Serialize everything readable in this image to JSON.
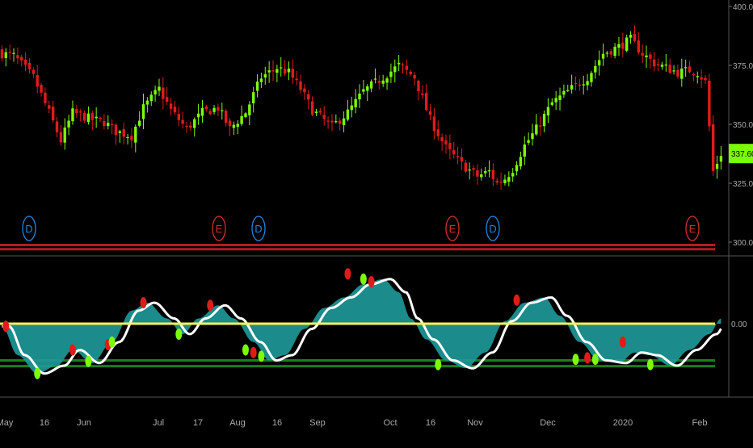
{
  "price_axis": {
    "ticks": [
      "400.00",
      "375.00",
      "350.00",
      "325.00",
      "300.00"
    ],
    "last_price": "337.60"
  },
  "osc_axis": {
    "ticks": [
      "0.00"
    ]
  },
  "time_axis": {
    "labels": [
      "May",
      "16",
      "Jun",
      "Jul",
      "17",
      "Aug",
      "16",
      "Sep",
      "Oct",
      "16",
      "Nov",
      "Dec",
      "2020",
      "Feb"
    ]
  },
  "event_markers": [
    "D",
    "E",
    "D",
    "E",
    "D",
    "E"
  ],
  "colors": {
    "background": "#000000",
    "up_candle": "#7CFC00",
    "down_candle": "#E01B1B",
    "oscillator_fill": "#1E9A9A",
    "oscillator_line": "#FFFFFF",
    "zero_line": "#F5F05A",
    "upper_band": "#B71C1C",
    "lower_band": "#1B7F1B",
    "dividend_marker": "#1E88E5",
    "earnings_marker": "#D32F2F",
    "last_price_tag": "#7CFC00"
  },
  "chart_data": [
    {
      "type": "candlestick",
      "title": "",
      "x_range": [
        0,
        183
      ],
      "ylim": [
        294,
        405
      ],
      "y_ticks": [
        300,
        325,
        350,
        375,
        400
      ],
      "grid": false,
      "last_price": 337.6,
      "close_anchors": [
        [
          0,
          380
        ],
        [
          3,
          379
        ],
        [
          8,
          370
        ],
        [
          12,
          355
        ],
        [
          15,
          343
        ],
        [
          18,
          355
        ],
        [
          23,
          352
        ],
        [
          26,
          351
        ],
        [
          29,
          347
        ],
        [
          33,
          345
        ],
        [
          36,
          357
        ],
        [
          40,
          365
        ],
        [
          43,
          356
        ],
        [
          47,
          348
        ],
        [
          51,
          355
        ],
        [
          55,
          357
        ],
        [
          58,
          348
        ],
        [
          62,
          355
        ],
        [
          66,
          370
        ],
        [
          70,
          374
        ],
        [
          73,
          372
        ],
        [
          76,
          365
        ],
        [
          79,
          356
        ],
        [
          84,
          349
        ],
        [
          88,
          355
        ],
        [
          92,
          364
        ],
        [
          97,
          370
        ],
        [
          101,
          375
        ],
        [
          105,
          370
        ],
        [
          109,
          352
        ],
        [
          113,
          340
        ],
        [
          117,
          333
        ],
        [
          121,
          328
        ],
        [
          124,
          330
        ],
        [
          126,
          325
        ],
        [
          128,
          327
        ],
        [
          130,
          331
        ],
        [
          133,
          341
        ],
        [
          136,
          348
        ],
        [
          140,
          359
        ],
        [
          144,
          364
        ],
        [
          149,
          370
        ],
        [
          153,
          380
        ],
        [
          157,
          383
        ],
        [
          160,
          386
        ],
        [
          163,
          380
        ],
        [
          166,
          376
        ],
        [
          169,
          374
        ],
        [
          172,
          372
        ],
        [
          175,
          373
        ],
        [
          177,
          372
        ],
        [
          179,
          368
        ],
        [
          181,
          330
        ],
        [
          183,
          337.6
        ]
      ],
      "date_labels": [
        "May",
        "16",
        "Jun",
        "Jul",
        "17",
        "Aug",
        "16",
        "Sep",
        "Oct",
        "16",
        "Nov",
        "Dec",
        "2020",
        "Feb"
      ],
      "event_markers": [
        {
          "label": "D",
          "type": "dividend"
        },
        {
          "label": "E",
          "type": "earnings"
        },
        {
          "label": "D",
          "type": "dividend"
        },
        {
          "label": "E",
          "type": "earnings"
        },
        {
          "label": "D",
          "type": "dividend"
        },
        {
          "label": "E",
          "type": "earnings"
        }
      ]
    },
    {
      "type": "area",
      "series_type": "oscillator",
      "ylim": [
        -1.2,
        1.2
      ],
      "y_ticks": [
        0
      ],
      "zero_line": 0,
      "upper_band_lines": [
        0.95,
        0.87
      ],
      "lower_band_lines": [
        -0.7,
        -0.81
      ],
      "curve": [
        [
          0,
          -0.05
        ],
        [
          4,
          -0.6
        ],
        [
          9,
          -0.95
        ],
        [
          14,
          -0.8
        ],
        [
          18,
          -0.5
        ],
        [
          23,
          -0.75
        ],
        [
          28,
          -0.35
        ],
        [
          33,
          0.25
        ],
        [
          37,
          0.4
        ],
        [
          42,
          0.1
        ],
        [
          46,
          -0.2
        ],
        [
          50,
          0.1
        ],
        [
          55,
          0.35
        ],
        [
          59,
          0.1
        ],
        [
          64,
          -0.35
        ],
        [
          68,
          -0.7
        ],
        [
          72,
          -0.6
        ],
        [
          77,
          -0.1
        ],
        [
          82,
          0.3
        ],
        [
          87,
          0.5
        ],
        [
          92,
          0.75
        ],
        [
          97,
          0.85
        ],
        [
          101,
          0.6
        ],
        [
          104,
          0.1
        ],
        [
          108,
          -0.3
        ],
        [
          113,
          -0.7
        ],
        [
          118,
          -0.85
        ],
        [
          123,
          -0.55
        ],
        [
          128,
          0.05
        ],
        [
          133,
          0.4
        ],
        [
          138,
          0.5
        ],
        [
          142,
          0.15
        ],
        [
          147,
          -0.35
        ],
        [
          152,
          -0.7
        ],
        [
          157,
          -0.75
        ],
        [
          161,
          -0.55
        ],
        [
          165,
          -0.6
        ],
        [
          170,
          -0.8
        ],
        [
          175,
          -0.5
        ],
        [
          180,
          -0.2
        ],
        [
          183,
          0.1
        ]
      ],
      "markers": [
        {
          "t": 1,
          "v": -0.05,
          "signal": "sell"
        },
        {
          "t": 9,
          "v": -0.95,
          "signal": "buy"
        },
        {
          "t": 18,
          "v": -0.5,
          "signal": "sell"
        },
        {
          "t": 22,
          "v": -0.72,
          "signal": "buy"
        },
        {
          "t": 27,
          "v": -0.4,
          "signal": "sell"
        },
        {
          "t": 28,
          "v": -0.35,
          "signal": "buy"
        },
        {
          "t": 36,
          "v": 0.4,
          "signal": "sell"
        },
        {
          "t": 45,
          "v": -0.2,
          "signal": "buy"
        },
        {
          "t": 53,
          "v": 0.35,
          "signal": "sell"
        },
        {
          "t": 62,
          "v": -0.5,
          "signal": "buy"
        },
        {
          "t": 64,
          "v": -0.55,
          "signal": "sell"
        },
        {
          "t": 66,
          "v": -0.62,
          "signal": "buy"
        },
        {
          "t": 88,
          "v": 0.95,
          "signal": "sell"
        },
        {
          "t": 92,
          "v": 0.85,
          "signal": "buy"
        },
        {
          "t": 94,
          "v": 0.8,
          "signal": "sell"
        },
        {
          "t": 111,
          "v": -0.78,
          "signal": "buy"
        },
        {
          "t": 131,
          "v": 0.45,
          "signal": "sell"
        },
        {
          "t": 146,
          "v": -0.68,
          "signal": "buy"
        },
        {
          "t": 149,
          "v": -0.65,
          "signal": "sell"
        },
        {
          "t": 151,
          "v": -0.68,
          "signal": "buy"
        },
        {
          "t": 158,
          "v": -0.35,
          "signal": "sell"
        },
        {
          "t": 165,
          "v": -0.78,
          "signal": "buy"
        }
      ]
    }
  ]
}
